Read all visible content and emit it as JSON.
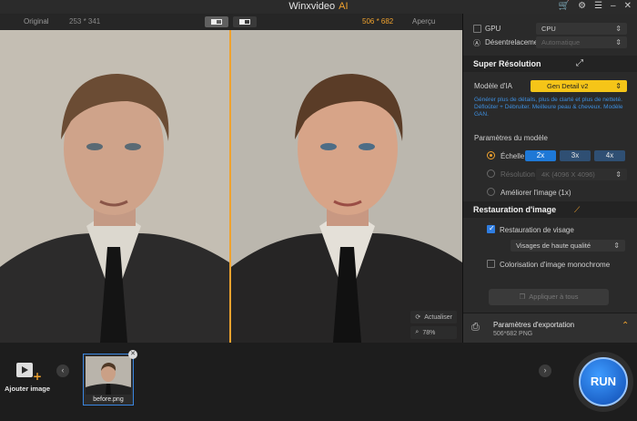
{
  "app": {
    "title": "Winxvideo",
    "title_accent": "AI"
  },
  "preview": {
    "label_original": "Original",
    "original_resolution": "253 * 341",
    "output_resolution": "506 * 682",
    "label_preview": "Aperçu",
    "refresh_label": "Actualiser",
    "zoom": "78%"
  },
  "settings": {
    "gpu_label": "GPU",
    "gpu_value": "CPU",
    "deinterlace_label": "Désentrelacement",
    "deinterlace_value": "Automatique",
    "super_resolution": {
      "title": "Super Résolution",
      "model_label": "Modèle d'IA",
      "model_value": "Gen Detail v2",
      "description": "Générer plus de détails, plus de clarté et plus de netteté. Défloûter + Débruiter. Meilleure peau & cheveux. Modèle GAN.",
      "params_label": "Paramètres du modèle",
      "scale_label": "Échelle",
      "scales": [
        "2x",
        "3x",
        "4x"
      ],
      "selected_scale": "2x",
      "resolution_label": "Résolution",
      "resolution_value": "4K (4096 X 4096)",
      "enhance_label": "Améliorer l'image (1x)"
    },
    "restoration": {
      "title": "Restauration d'image",
      "face_label": "Restauration de visage",
      "face_checked": true,
      "face_quality": "Visages de haute qualité",
      "colorize_label": "Colorisation d'image monochrome",
      "colorize_checked": false
    },
    "apply_all_label": "Appliquer à tous",
    "export": {
      "title": "Paramètres d'exportation",
      "details": "506*682  PNG"
    }
  },
  "bottom": {
    "add_image_label": "Ajouter image",
    "files": [
      {
        "name": "before.png"
      }
    ],
    "run_label": "RUN"
  },
  "colors": {
    "accent_orange": "#f0a22e",
    "accent_blue": "#1e78d6",
    "link_blue": "#3d8fe0"
  }
}
